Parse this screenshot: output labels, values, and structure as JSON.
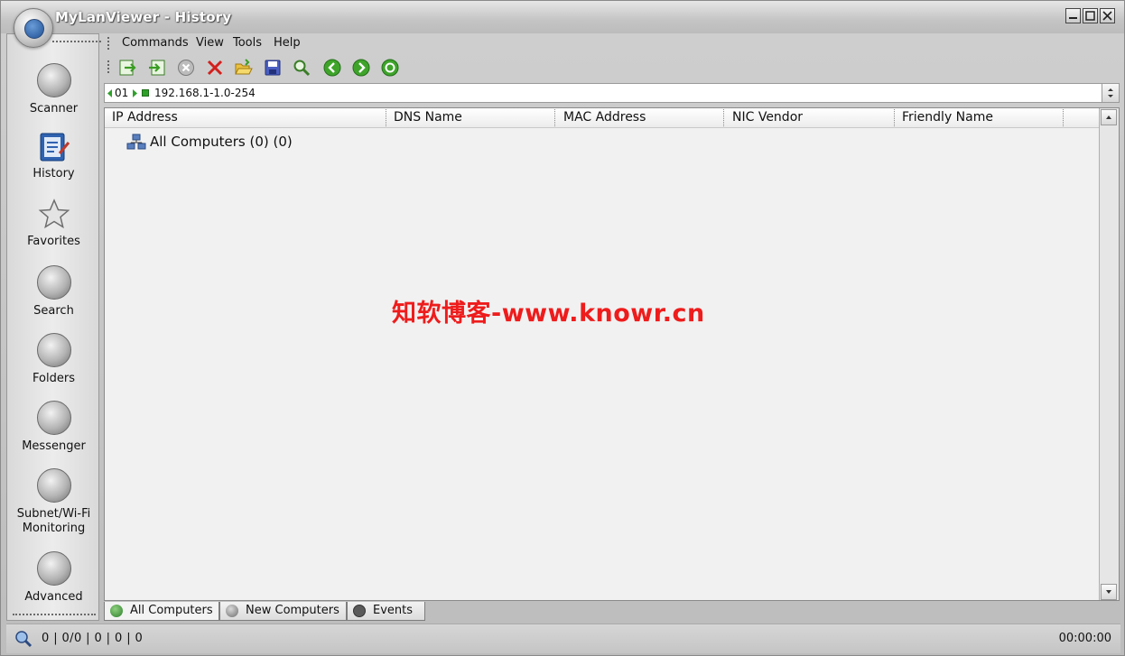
{
  "window": {
    "title": "MyLanViewer - History",
    "controls": [
      "minimize",
      "maximize",
      "close"
    ]
  },
  "sidebar": {
    "items": [
      {
        "label": "Scanner",
        "icon": "scanner-icon"
      },
      {
        "label": "History",
        "icon": "history-icon",
        "active": true
      },
      {
        "label": "Favorites",
        "icon": "star-icon"
      },
      {
        "label": "Search",
        "icon": "search-icon"
      },
      {
        "label": "Folders",
        "icon": "folders-icon"
      },
      {
        "label": "Messenger",
        "icon": "messenger-icon"
      },
      {
        "label": "Subnet/Wi-Fi",
        "label2": "Monitoring",
        "icon": "monitoring-icon"
      },
      {
        "label": "Advanced",
        "icon": "advanced-icon"
      }
    ]
  },
  "menubar": {
    "items": [
      "Commands",
      "View",
      "Tools",
      "Help"
    ]
  },
  "toolbar": {
    "buttons": [
      "export-icon",
      "import-icon",
      "cancel-icon",
      "delete-icon",
      "open-folder-icon",
      "save-icon",
      "find-icon",
      "back-icon",
      "forward-icon",
      "refresh-icon"
    ]
  },
  "address_bar": {
    "prefix": "01",
    "range": "192.168.1-1.0-254"
  },
  "list": {
    "columns": [
      "IP Address",
      "DNS Name",
      "MAC Address",
      "NIC Vendor",
      "Friendly Name"
    ],
    "root": "All Computers (0) (0)"
  },
  "watermark": "知软博客-www.knowr.cn",
  "tabs": [
    "All Computers",
    "New Computers",
    "Events"
  ],
  "status": {
    "counts": "0 | 0/0 | 0 | 0 | 0",
    "time": "00:00:00"
  },
  "colors": {
    "watermark": "#ee1c1c",
    "title_text": "#ffffff",
    "chrome": "#c4c4c4"
  }
}
